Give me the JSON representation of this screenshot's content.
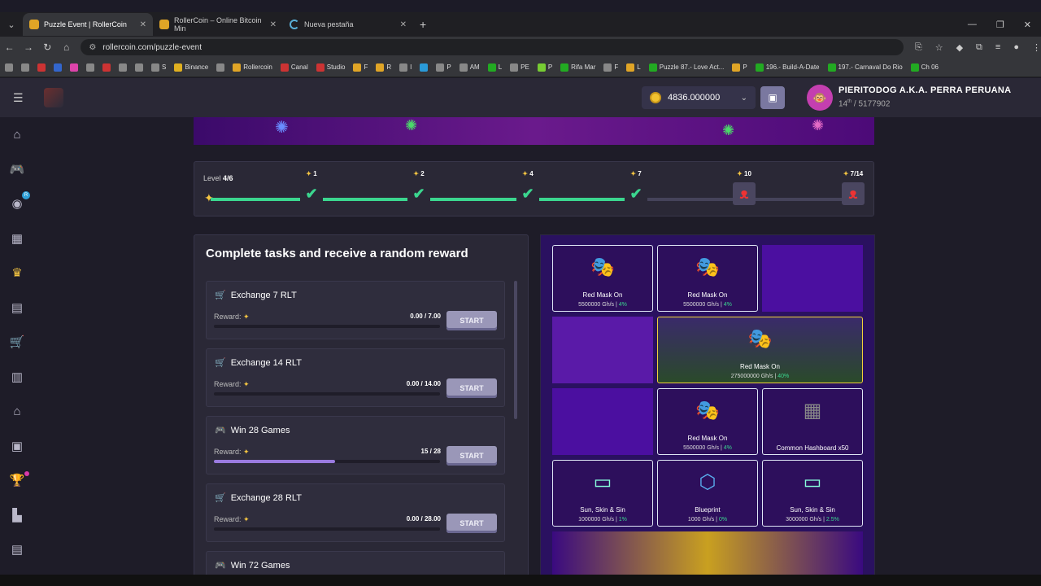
{
  "browser": {
    "tabs": [
      {
        "title": "Puzzle Event | RollerCoin",
        "active": true
      },
      {
        "title": "RollerCoin – Online Bitcoin Min",
        "active": false
      },
      {
        "title": "Nueva pestaña",
        "active": false
      }
    ],
    "url": "rollercoin.com/puzzle-event",
    "bookmarks": [
      "S",
      "Binance",
      "Rollercoin",
      "Canal",
      "Studio",
      "F",
      "R",
      "I",
      "P",
      "AM",
      "L",
      "PE",
      "P",
      "Rifa Mar",
      "F",
      "L",
      "Puzzle 87.- Love Act...",
      "P",
      "196.- Build-A-Date",
      "197.- Carnaval Do Rio",
      "Ch 06"
    ]
  },
  "header": {
    "balance": "4836.000000",
    "user_name": "PIERITODOG A.K.A. PERRA PERUANA",
    "rank": "14",
    "rank_suffix": "th",
    "rank_total": "/ 5177902"
  },
  "levels": {
    "label": "Level",
    "current": "4/6",
    "milestones": [
      "1",
      "2",
      "4",
      "7",
      "10",
      "7/14"
    ]
  },
  "tasks": {
    "title": "Complete tasks and receive a random reward",
    "reward_label": "Reward:",
    "start_label": "START",
    "items": [
      {
        "title": "Exchange 7 RLT",
        "progress": "0.00 / 7.00",
        "fraction": 0
      },
      {
        "title": "Exchange 14 RLT",
        "progress": "0.00 / 14.00",
        "fraction": 0
      },
      {
        "title": "Win 28 Games",
        "progress": "15 / 28",
        "fraction": 0.536
      },
      {
        "title": "Exchange 28 RLT",
        "progress": "0.00 / 28.00",
        "fraction": 0
      },
      {
        "title": "Win 72 Games",
        "progress": "",
        "fraction": 0
      }
    ]
  },
  "puzzle": {
    "tiles": [
      {
        "name": "Red Mask On",
        "power": "5500000 Gh/s",
        "bonus": "4%"
      },
      {
        "name": "Red Mask On",
        "power": "5500000 Gh/s",
        "bonus": "4%"
      },
      {
        "name": "Red Mask On",
        "power": "275000000 Gh/s",
        "bonus": "40%"
      },
      {
        "name": "Red Mask On",
        "power": "5500000 Gh/s",
        "bonus": "4%"
      },
      {
        "name": "Common Hashboard x50",
        "power": "",
        "bonus": ""
      },
      {
        "name": "Sun, Skin & Sin",
        "power": "1000000 Gh/s",
        "bonus": "1%"
      },
      {
        "name": "Blueprint",
        "power": "1000 Gh/s",
        "bonus": "0%"
      },
      {
        "name": "Sun, Skin & Sin",
        "power": "3000000 Gh/s",
        "bonus": "2.5%"
      }
    ]
  }
}
